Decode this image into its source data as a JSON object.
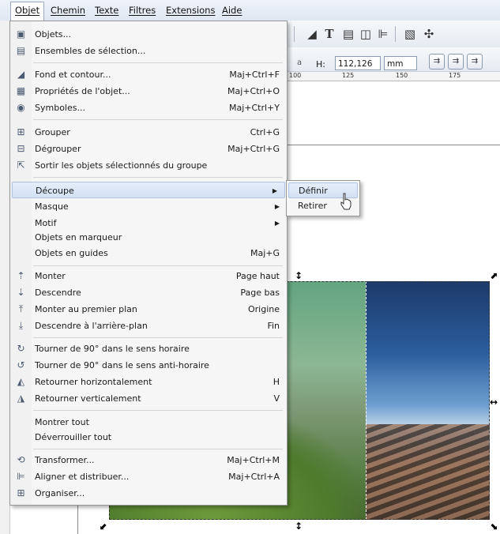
{
  "menubar": {
    "items": [
      {
        "label": "Objet",
        "active": true
      },
      {
        "label": "Chemin"
      },
      {
        "label": "Texte"
      },
      {
        "label": "Filtres"
      },
      {
        "label": "Extensions"
      },
      {
        "label": "Aide"
      }
    ]
  },
  "toolbar": {
    "h_label": "H:",
    "h_value": "112,126",
    "unit": "mm",
    "a_label": "a"
  },
  "ruler": {
    "ticks": [
      "100",
      "125",
      "150",
      "175"
    ]
  },
  "menu": {
    "items": [
      {
        "label": "Objets...",
        "icon": "objects-icon",
        "glyph": "▣"
      },
      {
        "label": "Ensembles de sélection...",
        "icon": "selection-sets-icon",
        "glyph": "▤"
      },
      {
        "label": "Fond et contour...",
        "shortcut": "Maj+Ctrl+F",
        "icon": "fill-stroke-icon",
        "glyph": "◢"
      },
      {
        "label": "Propriétés de l'objet...",
        "shortcut": "Maj+Ctrl+O",
        "icon": "object-properties-icon",
        "glyph": "▦"
      },
      {
        "label": "Symboles...",
        "shortcut": "Maj+Ctrl+Y",
        "icon": "symbols-icon",
        "glyph": "◉"
      },
      {
        "label": "Grouper",
        "shortcut": "Ctrl+G",
        "icon": "group-icon",
        "glyph": "⊞"
      },
      {
        "label": "Dégrouper",
        "shortcut": "Maj+Ctrl+G",
        "icon": "ungroup-icon",
        "glyph": "⊟"
      },
      {
        "label": "Sortir les objets sélectionnés du groupe",
        "icon": "pop-out-group-icon",
        "glyph": "⇱"
      },
      {
        "label": "Découpe",
        "submenu": true
      },
      {
        "label": "Masque",
        "submenu": true
      },
      {
        "label": "Motif",
        "submenu": true
      },
      {
        "label": "Objets en marqueur"
      },
      {
        "label": "Objets en guides",
        "shortcut": "Maj+G"
      },
      {
        "label": "Monter",
        "shortcut": "Page haut",
        "icon": "raise-icon",
        "glyph": "⇡"
      },
      {
        "label": "Descendre",
        "shortcut": "Page bas",
        "icon": "lower-icon",
        "glyph": "⇣"
      },
      {
        "label": "Monter au premier plan",
        "shortcut": "Origine",
        "icon": "raise-to-top-icon",
        "glyph": "⤒"
      },
      {
        "label": "Descendre à l'arrière-plan",
        "shortcut": "Fin",
        "icon": "lower-to-bottom-icon",
        "glyph": "⤓"
      },
      {
        "label": "Tourner de 90° dans le sens horaire",
        "icon": "rotate-cw-icon",
        "glyph": "↻"
      },
      {
        "label": "Tourner de 90° dans le sens anti-horaire",
        "icon": "rotate-ccw-icon",
        "glyph": "↺"
      },
      {
        "label": "Retourner horizontalement",
        "shortcut": "H",
        "icon": "flip-horizontal-icon",
        "glyph": "◭"
      },
      {
        "label": "Retourner verticalement",
        "shortcut": "V",
        "icon": "flip-vertical-icon",
        "glyph": "◮"
      },
      {
        "label": "Montrer tout"
      },
      {
        "label": "Déverrouiller tout"
      },
      {
        "label": "Transformer...",
        "shortcut": "Maj+Ctrl+M",
        "icon": "transform-icon",
        "glyph": "⟲"
      },
      {
        "label": "Aligner et distribuer...",
        "shortcut": "Maj+Ctrl+A",
        "icon": "align-icon",
        "glyph": "⊫"
      },
      {
        "label": "Organiser...",
        "icon": "arrange-icon",
        "glyph": "⊞"
      }
    ]
  },
  "submenu": {
    "items": [
      {
        "label": "Définir"
      },
      {
        "label": "Retirer"
      }
    ]
  }
}
